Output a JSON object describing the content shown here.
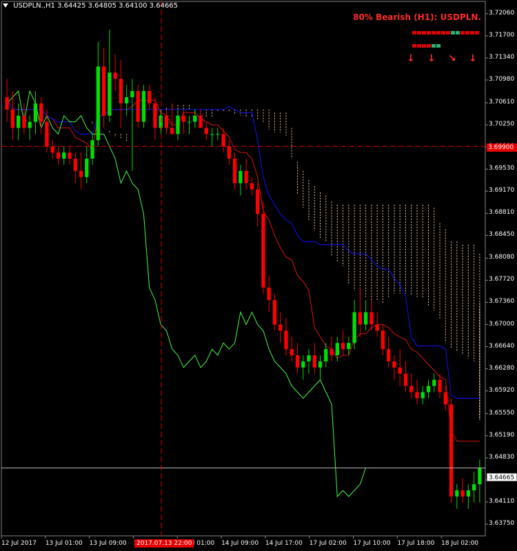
{
  "header": {
    "symbol": "USDPLN.,H1",
    "ohlc": "3.64425 3.64805 3.64100 3.64665"
  },
  "signal": {
    "text": "80% Bearish (H1): USDPLN.",
    "blocks": [
      "red",
      "red",
      "red",
      "red",
      "red",
      "red",
      "red",
      "red",
      "green",
      "green",
      "red",
      "red",
      "red",
      "red",
      "red",
      "red",
      "red",
      "red",
      "green",
      "green"
    ],
    "arrows": [
      "down",
      "down",
      "down-right",
      "down"
    ]
  },
  "colors": {
    "bull": "#00e000",
    "bear": "#ff0000",
    "blue": "#1010ff",
    "red_line": "#e01010",
    "green_line": "#40ff40",
    "cloud": "#f5c8a0",
    "tag_red": "#e60000"
  },
  "chart_data": {
    "type": "candlestick",
    "y_range": [
      3.6356,
      3.7226
    ],
    "y_ticks": [
      "3.72060",
      "3.71700",
      "3.71340",
      "3.70980",
      "3.70610",
      "3.70250",
      "3.69890",
      "3.69530",
      "3.69170",
      "3.68810",
      "3.68450",
      "3.68080",
      "3.67720",
      "3.67360",
      "3.67000",
      "3.66640",
      "3.66280",
      "3.65920",
      "3.65550",
      "3.65190",
      "3.64830",
      "3.64470",
      "3.64110",
      "3.63750"
    ],
    "x_ticks": [
      "12 Jul 2017",
      "13 Jul 01:00",
      "13 Jul 09:00",
      "13 Jul 17:00",
      "14 Jul 01:00",
      "14 Jul 09:00",
      "14 Jul 17:00",
      "17 Jul 02:00",
      "17 Jul 10:00",
      "17 Jul 18:00",
      "18 Jul 02:00"
    ],
    "h_line_red": "3.69900",
    "h_line_current": "3.64665",
    "crosshair_time": "2017.07.13 22:00",
    "candles": [
      [
        3.707,
        3.71,
        3.703,
        3.705
      ],
      [
        3.705,
        3.708,
        3.7,
        3.702
      ],
      [
        3.702,
        3.706,
        3.7,
        3.704
      ],
      [
        3.704,
        3.706,
        3.701,
        3.702
      ],
      [
        3.702,
        3.704,
        3.7,
        3.703
      ],
      [
        3.703,
        3.708,
        3.701,
        3.706
      ],
      [
        3.706,
        3.707,
        3.701,
        3.703
      ],
      [
        3.703,
        3.705,
        3.698,
        3.699
      ],
      [
        3.699,
        3.7,
        3.697,
        3.698
      ],
      [
        3.698,
        3.699,
        3.696,
        3.697
      ],
      [
        3.697,
        3.699,
        3.696,
        3.698
      ],
      [
        3.698,
        3.699,
        3.696,
        3.697
      ],
      [
        3.697,
        3.698,
        3.693,
        3.695
      ],
      [
        3.695,
        3.698,
        3.692,
        3.694
      ],
      [
        3.694,
        3.699,
        3.693,
        3.697
      ],
      [
        3.697,
        3.701,
        3.696,
        3.7
      ],
      [
        3.7,
        3.716,
        3.699,
        3.712
      ],
      [
        3.712,
        3.715,
        3.702,
        3.704
      ],
      [
        3.704,
        3.718,
        3.703,
        3.711
      ],
      [
        3.711,
        3.714,
        3.708,
        3.71
      ],
      [
        3.71,
        3.713,
        3.702,
        3.706
      ],
      [
        3.706,
        3.709,
        3.704,
        3.707
      ],
      [
        3.707,
        3.71,
        3.695,
        3.708
      ],
      [
        3.708,
        3.709,
        3.702,
        3.703
      ],
      [
        3.703,
        3.709,
        3.702,
        3.708
      ],
      [
        3.708,
        3.709,
        3.705,
        3.706
      ],
      [
        3.706,
        3.707,
        3.7,
        3.702
      ],
      [
        3.702,
        3.705,
        3.701,
        3.704
      ],
      [
        3.704,
        3.705,
        3.701,
        3.702
      ],
      [
        3.702,
        3.706,
        3.701,
        3.701
      ],
      [
        3.701,
        3.705,
        3.7,
        3.704
      ],
      [
        3.704,
        3.705,
        3.701,
        3.703
      ],
      [
        3.703,
        3.704,
        3.701,
        3.703
      ],
      [
        3.703,
        3.705,
        3.702,
        3.704
      ],
      [
        3.704,
        3.705,
        3.702,
        3.702
      ],
      [
        3.702,
        3.703,
        3.7,
        3.701
      ],
      [
        3.701,
        3.702,
        3.699,
        3.701
      ],
      [
        3.701,
        3.702,
        3.7,
        3.701
      ],
      [
        3.701,
        3.702,
        3.698,
        3.699
      ],
      [
        3.699,
        3.7,
        3.696,
        3.697
      ],
      [
        3.697,
        3.698,
        3.692,
        3.693
      ],
      [
        3.693,
        3.696,
        3.691,
        3.695
      ],
      [
        3.695,
        3.697,
        3.692,
        3.693
      ],
      [
        3.693,
        3.694,
        3.691,
        3.692
      ],
      [
        3.692,
        3.693,
        3.686,
        3.688
      ],
      [
        3.688,
        3.69,
        3.675,
        3.676
      ],
      [
        3.676,
        3.678,
        3.672,
        3.674
      ],
      [
        3.674,
        3.675,
        3.669,
        3.67
      ],
      [
        3.67,
        3.672,
        3.667,
        3.669
      ],
      [
        3.669,
        3.671,
        3.665,
        3.666
      ],
      [
        3.666,
        3.668,
        3.664,
        3.665
      ],
      [
        3.665,
        3.667,
        3.662,
        3.663
      ],
      [
        3.663,
        3.665,
        3.661,
        3.664
      ],
      [
        3.664,
        3.666,
        3.662,
        3.665
      ],
      [
        3.665,
        3.667,
        3.662,
        3.663
      ],
      [
        3.663,
        3.665,
        3.661,
        3.664
      ],
      [
        3.664,
        3.667,
        3.663,
        3.666
      ],
      [
        3.666,
        3.668,
        3.664,
        3.665
      ],
      [
        3.665,
        3.668,
        3.664,
        3.667
      ],
      [
        3.667,
        3.669,
        3.665,
        3.666
      ],
      [
        3.666,
        3.668,
        3.665,
        3.667
      ],
      [
        3.667,
        3.674,
        3.666,
        3.672
      ],
      [
        3.672,
        3.676,
        3.668,
        3.67
      ],
      [
        3.67,
        3.674,
        3.669,
        3.672
      ],
      [
        3.672,
        3.674,
        3.669,
        3.67
      ],
      [
        3.67,
        3.672,
        3.668,
        3.669
      ],
      [
        3.669,
        3.67,
        3.665,
        3.666
      ],
      [
        3.666,
        3.668,
        3.663,
        3.664
      ],
      [
        3.664,
        3.665,
        3.661,
        3.663
      ],
      [
        3.663,
        3.666,
        3.66,
        3.662
      ],
      [
        3.662,
        3.664,
        3.659,
        3.66
      ],
      [
        3.66,
        3.662,
        3.658,
        3.659
      ],
      [
        3.659,
        3.661,
        3.657,
        3.658
      ],
      [
        3.658,
        3.66,
        3.657,
        3.659
      ],
      [
        3.659,
        3.661,
        3.658,
        3.66
      ],
      [
        3.66,
        3.662,
        3.659,
        3.661
      ],
      [
        3.661,
        3.662,
        3.658,
        3.659
      ],
      [
        3.659,
        3.66,
        3.656,
        3.657
      ],
      [
        3.657,
        3.658,
        3.641,
        3.642
      ],
      [
        3.642,
        3.644,
        3.64,
        3.643
      ],
      [
        3.643,
        3.645,
        3.641,
        3.642
      ],
      [
        3.642,
        3.644,
        3.64,
        3.643
      ],
      [
        3.643,
        3.646,
        3.641,
        3.644
      ],
      [
        3.644,
        3.648,
        3.641,
        3.6467
      ]
    ]
  }
}
